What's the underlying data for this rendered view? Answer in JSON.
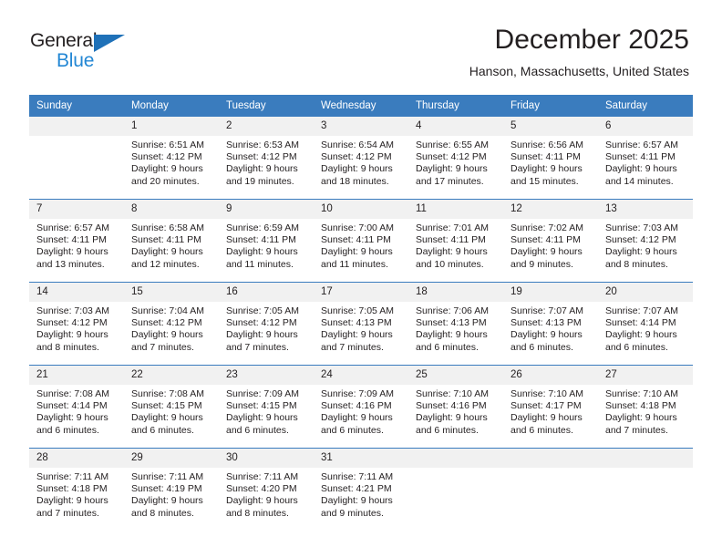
{
  "brand": {
    "name_part1": "General",
    "name_part2": "Blue",
    "triangle_color": "#1f71b8",
    "blue_text_color": "#2387d4"
  },
  "header": {
    "month_title": "December 2025",
    "location": "Hanson, Massachusetts, United States"
  },
  "theme": {
    "header_blue": "#3a7cbe",
    "daynum_band": "#f1f1f1",
    "text": "#231f20"
  },
  "calendar": {
    "weekday_headers": [
      "Sunday",
      "Monday",
      "Tuesday",
      "Wednesday",
      "Thursday",
      "Friday",
      "Saturday"
    ],
    "weeks": [
      {
        "days": [
          {
            "date": "",
            "lines": []
          },
          {
            "date": "1",
            "lines": [
              "Sunrise: 6:51 AM",
              "Sunset: 4:12 PM",
              "Daylight: 9 hours",
              "and 20 minutes."
            ]
          },
          {
            "date": "2",
            "lines": [
              "Sunrise: 6:53 AM",
              "Sunset: 4:12 PM",
              "Daylight: 9 hours",
              "and 19 minutes."
            ]
          },
          {
            "date": "3",
            "lines": [
              "Sunrise: 6:54 AM",
              "Sunset: 4:12 PM",
              "Daylight: 9 hours",
              "and 18 minutes."
            ]
          },
          {
            "date": "4",
            "lines": [
              "Sunrise: 6:55 AM",
              "Sunset: 4:12 PM",
              "Daylight: 9 hours",
              "and 17 minutes."
            ]
          },
          {
            "date": "5",
            "lines": [
              "Sunrise: 6:56 AM",
              "Sunset: 4:11 PM",
              "Daylight: 9 hours",
              "and 15 minutes."
            ]
          },
          {
            "date": "6",
            "lines": [
              "Sunrise: 6:57 AM",
              "Sunset: 4:11 PM",
              "Daylight: 9 hours",
              "and 14 minutes."
            ]
          }
        ]
      },
      {
        "days": [
          {
            "date": "7",
            "lines": [
              "Sunrise: 6:57 AM",
              "Sunset: 4:11 PM",
              "Daylight: 9 hours",
              "and 13 minutes."
            ]
          },
          {
            "date": "8",
            "lines": [
              "Sunrise: 6:58 AM",
              "Sunset: 4:11 PM",
              "Daylight: 9 hours",
              "and 12 minutes."
            ]
          },
          {
            "date": "9",
            "lines": [
              "Sunrise: 6:59 AM",
              "Sunset: 4:11 PM",
              "Daylight: 9 hours",
              "and 11 minutes."
            ]
          },
          {
            "date": "10",
            "lines": [
              "Sunrise: 7:00 AM",
              "Sunset: 4:11 PM",
              "Daylight: 9 hours",
              "and 11 minutes."
            ]
          },
          {
            "date": "11",
            "lines": [
              "Sunrise: 7:01 AM",
              "Sunset: 4:11 PM",
              "Daylight: 9 hours",
              "and 10 minutes."
            ]
          },
          {
            "date": "12",
            "lines": [
              "Sunrise: 7:02 AM",
              "Sunset: 4:11 PM",
              "Daylight: 9 hours",
              "and 9 minutes."
            ]
          },
          {
            "date": "13",
            "lines": [
              "Sunrise: 7:03 AM",
              "Sunset: 4:12 PM",
              "Daylight: 9 hours",
              "and 8 minutes."
            ]
          }
        ]
      },
      {
        "days": [
          {
            "date": "14",
            "lines": [
              "Sunrise: 7:03 AM",
              "Sunset: 4:12 PM",
              "Daylight: 9 hours",
              "and 8 minutes."
            ]
          },
          {
            "date": "15",
            "lines": [
              "Sunrise: 7:04 AM",
              "Sunset: 4:12 PM",
              "Daylight: 9 hours",
              "and 7 minutes."
            ]
          },
          {
            "date": "16",
            "lines": [
              "Sunrise: 7:05 AM",
              "Sunset: 4:12 PM",
              "Daylight: 9 hours",
              "and 7 minutes."
            ]
          },
          {
            "date": "17",
            "lines": [
              "Sunrise: 7:05 AM",
              "Sunset: 4:13 PM",
              "Daylight: 9 hours",
              "and 7 minutes."
            ]
          },
          {
            "date": "18",
            "lines": [
              "Sunrise: 7:06 AM",
              "Sunset: 4:13 PM",
              "Daylight: 9 hours",
              "and 6 minutes."
            ]
          },
          {
            "date": "19",
            "lines": [
              "Sunrise: 7:07 AM",
              "Sunset: 4:13 PM",
              "Daylight: 9 hours",
              "and 6 minutes."
            ]
          },
          {
            "date": "20",
            "lines": [
              "Sunrise: 7:07 AM",
              "Sunset: 4:14 PM",
              "Daylight: 9 hours",
              "and 6 minutes."
            ]
          }
        ]
      },
      {
        "days": [
          {
            "date": "21",
            "lines": [
              "Sunrise: 7:08 AM",
              "Sunset: 4:14 PM",
              "Daylight: 9 hours",
              "and 6 minutes."
            ]
          },
          {
            "date": "22",
            "lines": [
              "Sunrise: 7:08 AM",
              "Sunset: 4:15 PM",
              "Daylight: 9 hours",
              "and 6 minutes."
            ]
          },
          {
            "date": "23",
            "lines": [
              "Sunrise: 7:09 AM",
              "Sunset: 4:15 PM",
              "Daylight: 9 hours",
              "and 6 minutes."
            ]
          },
          {
            "date": "24",
            "lines": [
              "Sunrise: 7:09 AM",
              "Sunset: 4:16 PM",
              "Daylight: 9 hours",
              "and 6 minutes."
            ]
          },
          {
            "date": "25",
            "lines": [
              "Sunrise: 7:10 AM",
              "Sunset: 4:16 PM",
              "Daylight: 9 hours",
              "and 6 minutes."
            ]
          },
          {
            "date": "26",
            "lines": [
              "Sunrise: 7:10 AM",
              "Sunset: 4:17 PM",
              "Daylight: 9 hours",
              "and 6 minutes."
            ]
          },
          {
            "date": "27",
            "lines": [
              "Sunrise: 7:10 AM",
              "Sunset: 4:18 PM",
              "Daylight: 9 hours",
              "and 7 minutes."
            ]
          }
        ]
      },
      {
        "days": [
          {
            "date": "28",
            "lines": [
              "Sunrise: 7:11 AM",
              "Sunset: 4:18 PM",
              "Daylight: 9 hours",
              "and 7 minutes."
            ]
          },
          {
            "date": "29",
            "lines": [
              "Sunrise: 7:11 AM",
              "Sunset: 4:19 PM",
              "Daylight: 9 hours",
              "and 8 minutes."
            ]
          },
          {
            "date": "30",
            "lines": [
              "Sunrise: 7:11 AM",
              "Sunset: 4:20 PM",
              "Daylight: 9 hours",
              "and 8 minutes."
            ]
          },
          {
            "date": "31",
            "lines": [
              "Sunrise: 7:11 AM",
              "Sunset: 4:21 PM",
              "Daylight: 9 hours",
              "and 9 minutes."
            ]
          },
          {
            "date": "",
            "lines": []
          },
          {
            "date": "",
            "lines": []
          },
          {
            "date": "",
            "lines": []
          }
        ]
      }
    ]
  }
}
